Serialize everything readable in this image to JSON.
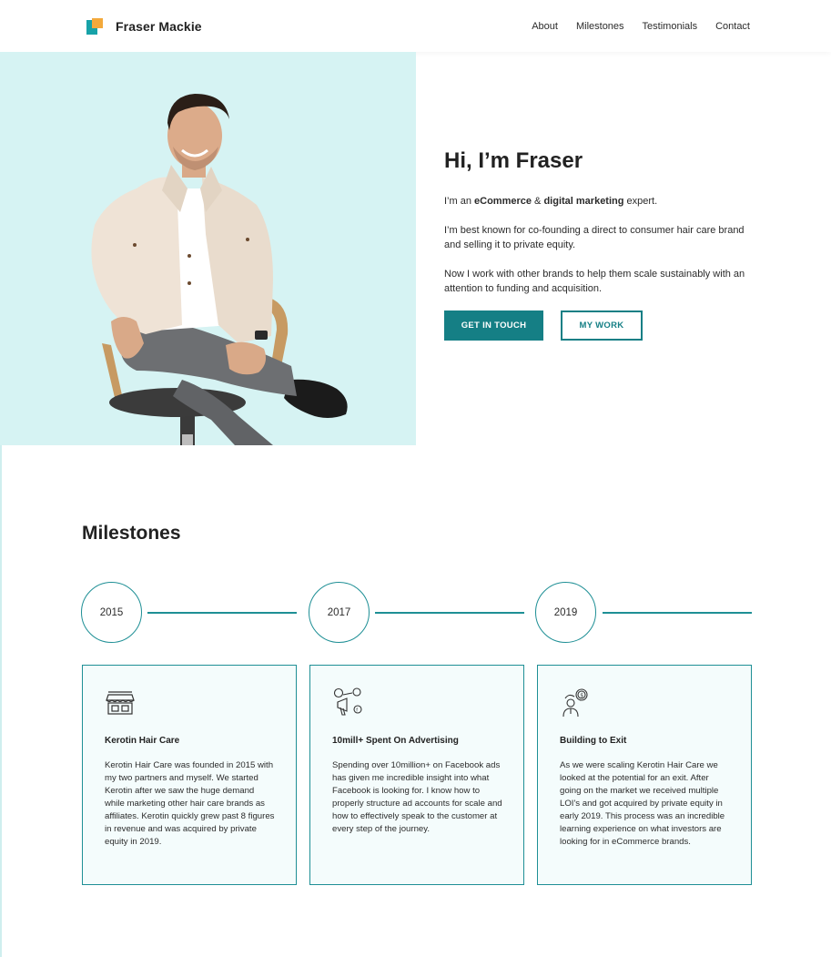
{
  "header": {
    "brand": "Fraser Mackie",
    "nav": [
      "About",
      "Milestones",
      "Testimonials",
      "Contact"
    ]
  },
  "hero": {
    "title": "Hi, I’m Fraser",
    "intro_prefix": "I’m an ",
    "intro_bold1": "eCommerce",
    "intro_mid": " & ",
    "intro_bold2": "digital marketing",
    "intro_suffix": " expert.",
    "paragraph2": "I’m best known for co-founding a direct to consumer hair care brand and selling it to private equity.",
    "paragraph3": "Now I work with other brands to help them scale sustainably with an attention to funding and acquisition.",
    "primary_button": "GET IN TOUCH",
    "secondary_button": "MY WORK",
    "photo_icon": "person-seated-photo"
  },
  "milestones": {
    "title": "Milestones",
    "years": [
      "2015",
      "2017",
      "2019"
    ],
    "cards": [
      {
        "icon": "storefront-icon",
        "title": "Kerotin Hair Care",
        "body": "Kerotin Hair Care was founded in 2015 with my two partners and myself. We started Kerotin after we saw the huge demand while marketing other hair care brands as affiliates. Kerotin quickly grew past 8 figures in revenue and was acquired by private equity in 2019."
      },
      {
        "icon": "social-advertising-icon",
        "title": "10mill+ Spent On Advertising",
        "body": "Spending over 10million+ on Facebook ads has given me incredible insight into what Facebook is looking for. I know how to properly structure ad accounts for scale and how to effectively speak to the customer at every step of the journey."
      },
      {
        "icon": "investor-exit-icon",
        "title": "Building to Exit",
        "body": "As we were scaling Kerotin Hair Care we looked at the potential for an exit. After going on the market we received multiple LOI's and got acquired by private equity in early 2019. This process was an incredible learning experience on what investors are looking for in eCommerce brands."
      }
    ]
  },
  "colors": {
    "accent": "#157f85",
    "hero_bg": "#d6f3f3",
    "card_bg": "#f4fcfc",
    "logo_teal": "#17a2a8",
    "logo_orange": "#f3a93b"
  }
}
